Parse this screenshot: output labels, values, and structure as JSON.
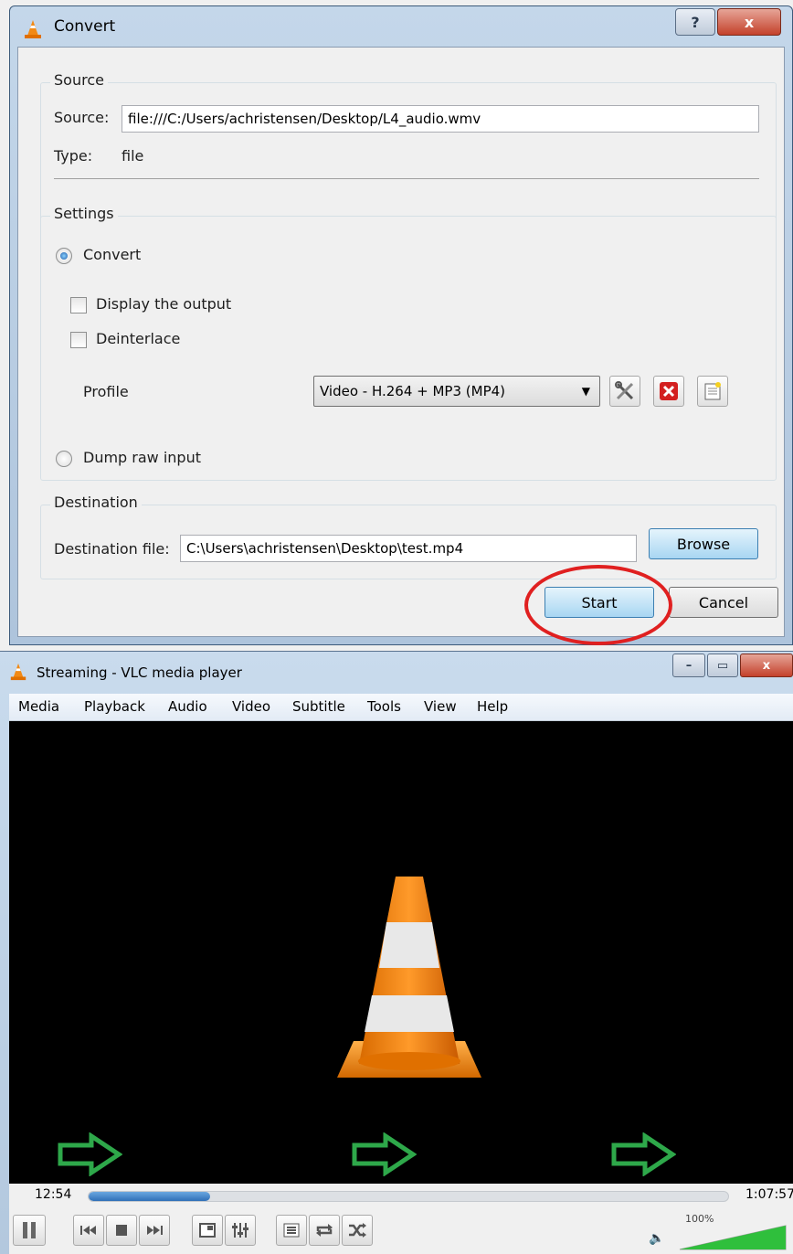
{
  "convert_dialog": {
    "title": "Convert",
    "help_label": "?",
    "close_label": "x",
    "source_group": {
      "legend": "Source",
      "source_label": "Source:",
      "source_value": "file:///C:/Users/achristensen/Desktop/L4_audio.wmv",
      "type_label": "Type:",
      "type_value": "file"
    },
    "settings_group": {
      "legend": "Settings",
      "convert_label": "Convert",
      "display_output_label": "Display the output",
      "deinterlace_label": "Deinterlace",
      "profile_label": "Profile",
      "profile_value": "Video - H.264 + MP3 (MP4)",
      "dump_raw_label": "Dump raw input"
    },
    "destination_group": {
      "legend": "Destination",
      "dest_label": "Destination file:",
      "dest_value": "C:\\Users\\achristensen\\Desktop\\test.mp4",
      "browse_label": "Browse"
    },
    "start_label": "Start",
    "cancel_label": "Cancel"
  },
  "vlc_window": {
    "title": "Streaming - VLC media player",
    "menu": [
      "Media",
      "Playback",
      "Audio",
      "Video",
      "Subtitle",
      "Tools",
      "View",
      "Help"
    ],
    "time_elapsed": "12:54",
    "time_total": "1:07:57",
    "progress_fraction": 0.19,
    "volume_label": "100%",
    "volume_fraction": 1.0
  },
  "colors": {
    "vlc_orange": "#f28a16",
    "highlight_red": "#e02020",
    "arrow_green": "#2ea84a"
  }
}
